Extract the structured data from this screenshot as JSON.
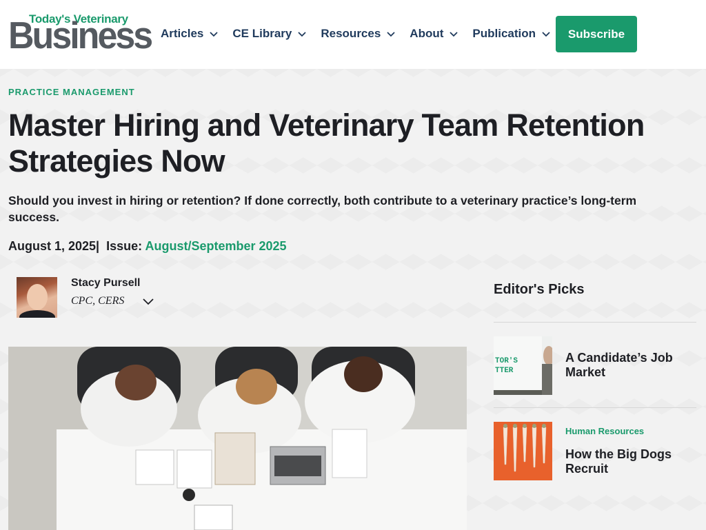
{
  "header": {
    "logo_top": "Today's Veterinary",
    "logo_main": "Business",
    "nav": [
      {
        "label": "Articles"
      },
      {
        "label": "CE Library"
      },
      {
        "label": "Resources"
      },
      {
        "label": "About"
      },
      {
        "label": "Publication"
      }
    ],
    "subscribe_label": "Subscribe"
  },
  "article": {
    "category": "PRACTICE MANAGEMENT",
    "title": "Master Hiring and Veterinary Team Retention Strategies Now",
    "subtitle": "Should you invest in hiring or retention? If done correctly, both contribute to a veterinary practice’s long-term success.",
    "date": "August 1, 2025",
    "separator": "|",
    "issue_label": "Issue:",
    "issue_value": "August/September 2025",
    "author": {
      "name": "Stacy Pursell",
      "credentials": "CPC, CERS"
    }
  },
  "sidebar": {
    "title": "Editor's Picks",
    "picks": [
      {
        "category": "",
        "title": "A Candidate’s Job Market",
        "thumb_text_1": "TOR'S",
        "thumb_text_2": "TTER"
      },
      {
        "category": "Human Resources",
        "title": "How the Big Dogs Recruit"
      }
    ]
  },
  "colors": {
    "brand_green": "#1a9a6c",
    "nav_navy": "#1f3a5c",
    "text_dark": "#1e1f24",
    "thumb_orange": "#e8612c"
  }
}
